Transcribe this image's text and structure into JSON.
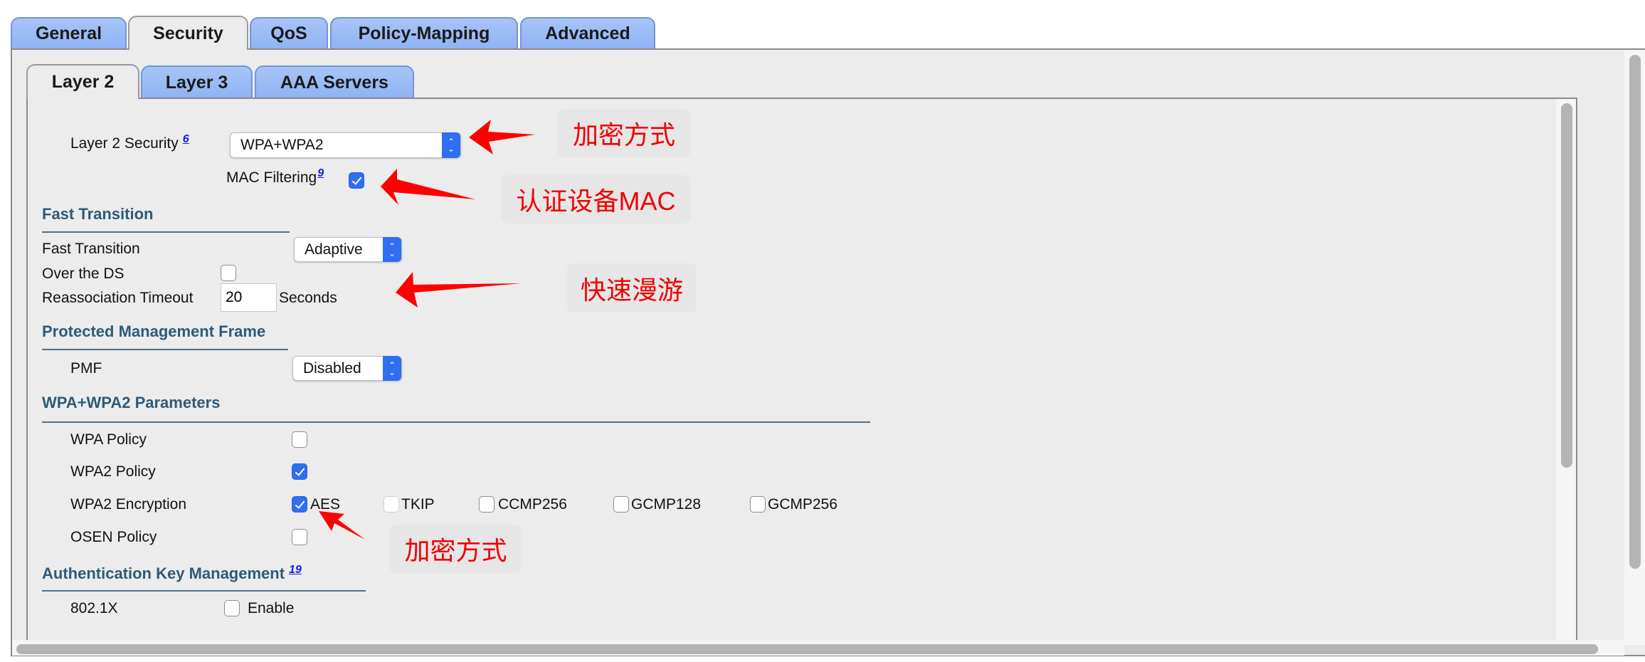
{
  "top_tabs": [
    "General",
    "Security",
    "QoS",
    "Policy-Mapping",
    "Advanced"
  ],
  "top_tabs_active": "Security",
  "sub_tabs": [
    "Layer 2",
    "Layer 3",
    "AAA Servers"
  ],
  "sub_tabs_active": "Layer 2",
  "layer2": {
    "security_label": "Layer 2 Security",
    "security_ref": "6",
    "security_value": "WPA+WPA2",
    "mac_filtering_label": "MAC Filtering",
    "mac_filtering_ref": "9",
    "mac_filtering_checked": true
  },
  "fast_transition": {
    "heading": "Fast Transition",
    "ft_label": "Fast Transition",
    "ft_value": "Adaptive",
    "over_ds_label": "Over the DS",
    "over_ds_checked": false,
    "reassoc_label": "Reassociation Timeout",
    "reassoc_value": "20",
    "reassoc_unit": "Seconds"
  },
  "pmf": {
    "heading": "Protected Management Frame",
    "label": "PMF",
    "value": "Disabled"
  },
  "wpa": {
    "heading": "WPA+WPA2 Parameters",
    "wpa_policy_label": "WPA Policy",
    "wpa_policy_checked": false,
    "wpa2_policy_label": "WPA2 Policy",
    "wpa2_policy_checked": true,
    "wpa2_encryption_label": "WPA2 Encryption",
    "encryption_options": [
      {
        "label": "AES",
        "checked": true
      },
      {
        "label": "TKIP",
        "checked": false
      },
      {
        "label": "CCMP256",
        "checked": false
      },
      {
        "label": "GCMP128",
        "checked": false
      },
      {
        "label": "GCMP256",
        "checked": false
      }
    ],
    "osen_policy_label": "OSEN Policy",
    "osen_policy_checked": false
  },
  "akm": {
    "heading": "Authentication Key Management",
    "ref": "19",
    "dot1x_label": "802.1X",
    "dot1x_enable_label": "Enable",
    "dot1x_checked": false
  },
  "annotations": [
    "加密方式",
    "认证设备MAC",
    "快速漫游",
    "加密方式"
  ],
  "colors": {
    "tab_blue": "#8fb3f3",
    "accent": "#2f6ef0",
    "heading": "#2f5a77",
    "annotation": "#f00000"
  }
}
